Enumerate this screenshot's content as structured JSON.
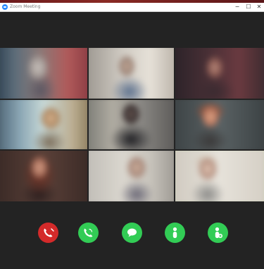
{
  "window": {
    "title": "Zoom Meeting",
    "controls": {
      "minimize": "−",
      "maximize": "☐",
      "close": "✕"
    }
  },
  "gallery": {
    "active_tile": 9,
    "tile_icon_names": [
      "participant-video-icon"
    ]
  },
  "controls": [
    {
      "name": "end-call",
      "icon": "phone-hangup-icon",
      "color": "#d42a2a"
    },
    {
      "name": "audio",
      "icon": "phone-icon",
      "color": "#32cc55"
    },
    {
      "name": "chat",
      "icon": "chat-bubble-icon",
      "color": "#32cc55"
    },
    {
      "name": "participants",
      "icon": "person-icon",
      "color": "#32cc55"
    },
    {
      "name": "invite",
      "icon": "add-person-icon",
      "color": "#32cc55"
    }
  ],
  "colors": {
    "background": "#232323",
    "active_speaker": "#8fcf5a",
    "end_call": "#d42a2a",
    "action": "#32cc55"
  }
}
